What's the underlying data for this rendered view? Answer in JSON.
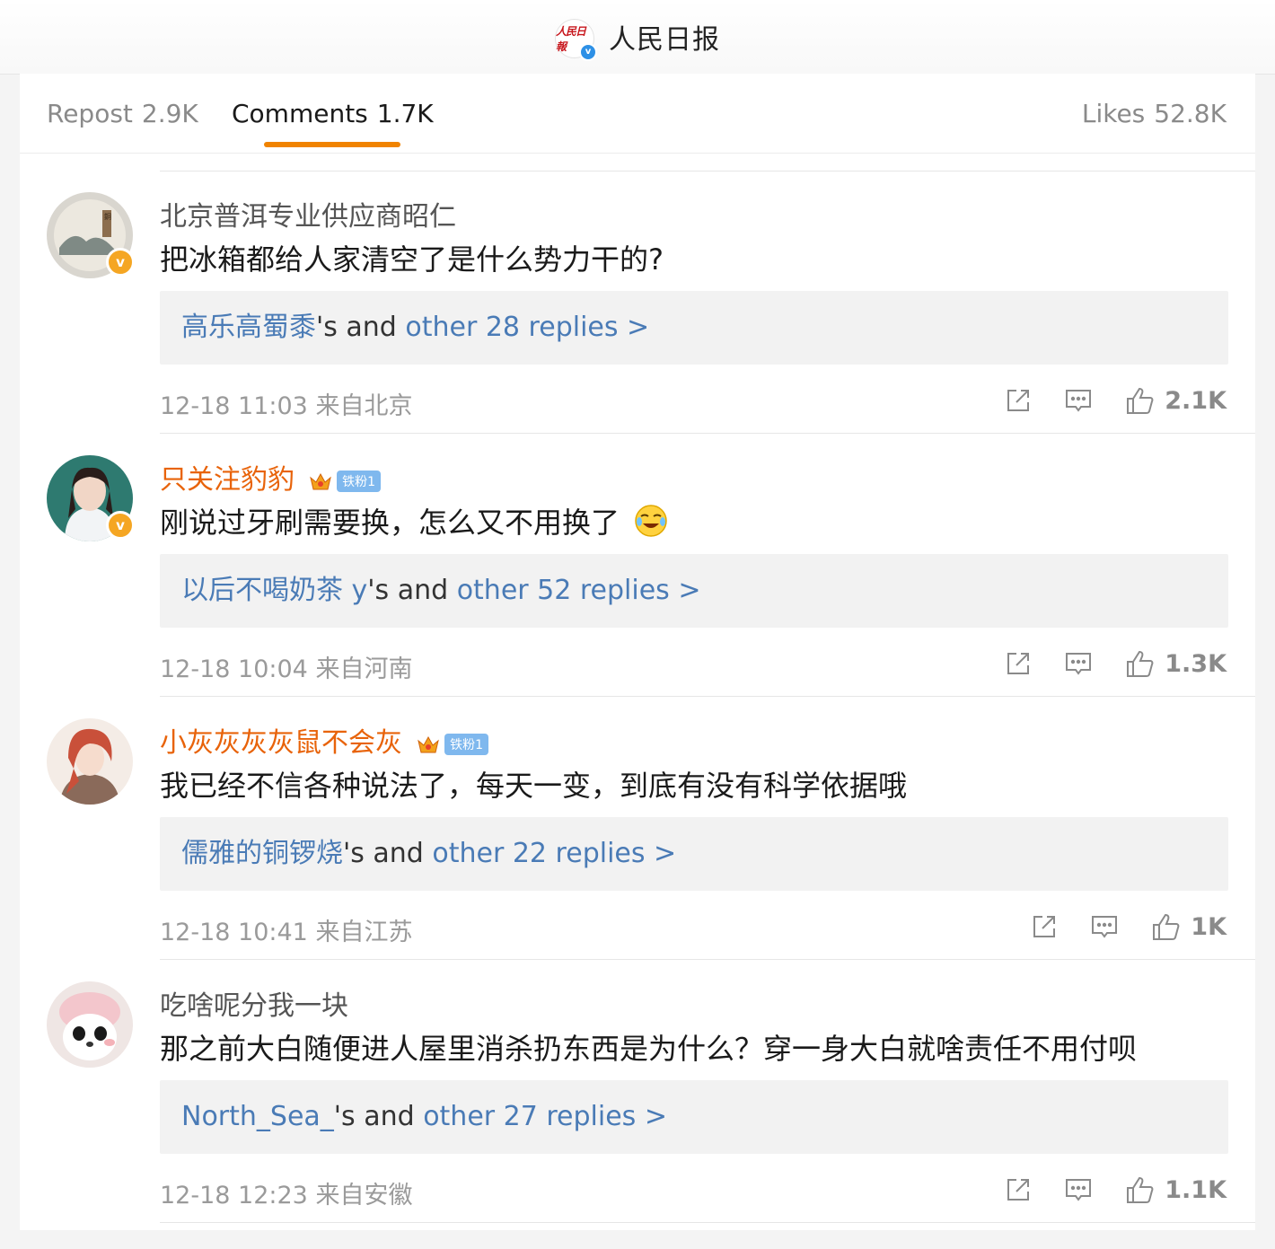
{
  "header": {
    "account_name": "人民日报",
    "logo_text": "人民日報"
  },
  "tabs": [
    {
      "label": "Repost",
      "count": "2.9K"
    },
    {
      "label": "Comments",
      "count": "1.7K"
    },
    {
      "label": "Likes",
      "count": "52.8K"
    }
  ],
  "comments": [
    {
      "username": "北京普洱专业供应商昭仁",
      "vip": false,
      "text": "把冰箱都给人家清空了是什么势力干的?",
      "reply_user": "高乐高蜀黍",
      "reply_mid": "'s and ",
      "reply_other": "other 28 replies >",
      "time": "12-18 11:03",
      "location": "来自北京",
      "likes": "2.1K"
    },
    {
      "username": "只关注豹豹",
      "vip": true,
      "fan_badge": "铁粉1",
      "text": "刚说过牙刷需要换，怎么又不用换了",
      "reply_user": "以后不喝奶茶 y",
      "reply_mid": "'s and ",
      "reply_other": "other 52 replies >",
      "time": "12-18 10:04",
      "location": "来自河南",
      "likes": "1.3K"
    },
    {
      "username": "小灰灰灰灰鼠不会灰",
      "vip": true,
      "fan_badge": "铁粉1",
      "text": "我已经不信各种说法了，每天一变，到底有没有科学依据哦",
      "reply_user": "儒雅的铜锣烧",
      "reply_mid": "'s and ",
      "reply_other": "other 22 replies >",
      "time": "12-18 10:41",
      "location": "来自江苏",
      "likes": "1K"
    },
    {
      "username": "吃啥呢分我一块",
      "vip": false,
      "text": "那之前大白随便进人屋里消杀扔东西是为什么？穿一身大白就啥责任不用付呗",
      "reply_user": "North_Sea_",
      "reply_mid": "'s and ",
      "reply_other": "other 27 replies >",
      "time": "12-18 12:23",
      "location": "来自安徽",
      "likes": "1.1K"
    }
  ],
  "colors": {
    "accent_underline": "#f08300",
    "vip_name": "#e8630a",
    "link_blue": "#4a7bb6",
    "verified_gold": "#f5a623",
    "verified_blue": "#2d90e6"
  }
}
